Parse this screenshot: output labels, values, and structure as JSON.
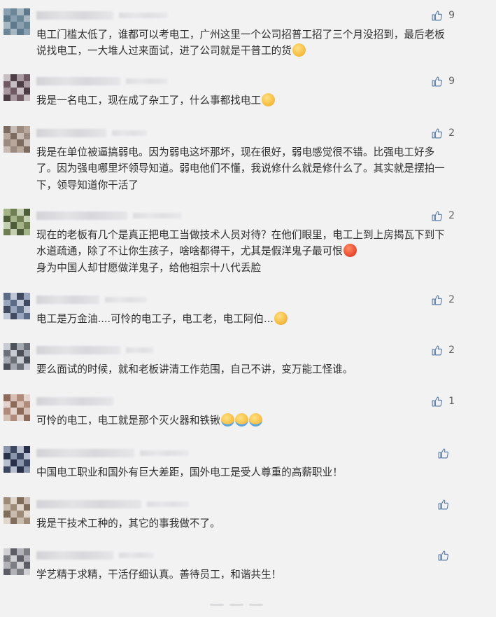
{
  "comments": [
    {
      "likes": "9",
      "text": "电工门槛太低了，谁都可以考电工，广州这里一个公司招普工招了三个月没招到，最后老板说找电工，一大堆人过来面试，进了公司就是干普工的货",
      "emoji": [
        "laugh"
      ]
    },
    {
      "likes": "9",
      "text": "我是一名电工，现在成了杂工了，什么事都找电工",
      "emoji": [
        "laugh"
      ]
    },
    {
      "likes": "2",
      "text": "我是在单位被逼搞弱电。因为弱电这坏那坏，现在很好，弱电感觉很不错。比强电工好多了。因为强电哪里坏领导知道。弱电他们不懂，我说修什么就是修什么了。其实就是摆拍一下，领导知道你干活了",
      "emoji": []
    },
    {
      "likes": "2",
      "text": "现在的老板有几个是真正把电工当做技术人员对待？在他们眼里，电工上到上房揭瓦下到下水道疏通，除了不让你生孩子，啥啥都得干，尤其是假洋鬼子最可恨",
      "emoji": [
        "angry"
      ],
      "text2": "身为中国人却甘愿做洋鬼子，给他祖宗十八代丢脸"
    },
    {
      "likes": "2",
      "text": "电工是万金油....可怜的电工子，电工老，电工阿伯...",
      "emoji": [
        "think"
      ]
    },
    {
      "likes": "2",
      "text": "要么面试的时候，就和老板讲清工作范围，自己不讲，变万能工怪谁。",
      "emoji": []
    },
    {
      "likes": "1",
      "text": "可怜的电工，电工就是那个灭火器和铁锹",
      "emoji": [
        "cry",
        "cry",
        "cry"
      ]
    },
    {
      "likes": "",
      "text": "中国电工职业和国外有巨大差距，国外电工是受人尊重的高薪职业！",
      "emoji": []
    },
    {
      "likes": "",
      "text": "我是干技术工种的，其它的事我做不了。",
      "emoji": []
    },
    {
      "likes": "",
      "text": "学艺精于求精，干活仔细认真。善待员工，和谐共生！",
      "emoji": []
    }
  ],
  "icons": {
    "like": "thumbs-up-icon"
  },
  "colors": {
    "background": "#f2f2f3",
    "like_icon": "#5c7ea8",
    "text": "#2e2e2e"
  }
}
